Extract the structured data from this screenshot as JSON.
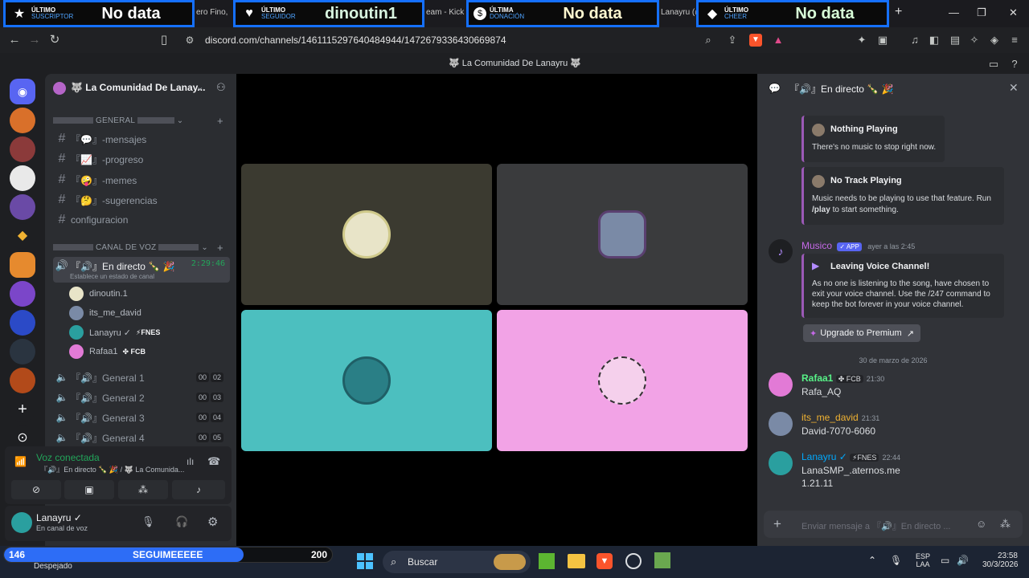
{
  "overlay": {
    "widgets": [
      {
        "small_top": "ÚLTIMO",
        "small_bottom": "SUSCRIPTOR",
        "value": "No data",
        "icon": "star-icon"
      },
      {
        "small_top": "ÚLTIMO",
        "small_bottom": "SEGUIDOR",
        "value": "dinoutin1",
        "icon": "heart-icon"
      },
      {
        "small_top": "ÚLTIMA",
        "small_bottom": "DONACIÓN",
        "value": "No data",
        "icon": "dollar-icon"
      },
      {
        "small_top": "ÚLTIMO",
        "small_bottom": "CHEER",
        "value": "No data",
        "icon": "diamond-icon"
      }
    ],
    "tab_fragments": [
      "ero Fino,",
      "eam - Kick",
      "Lanayru (@"
    ],
    "follow_bar": {
      "current": "146",
      "label": "SEGUIMEEEEE",
      "goal": "200",
      "progress": 0.73
    },
    "weather": "Despejado"
  },
  "browser": {
    "url": "discord.com/channels/1461115297640484944/1472679336430669874",
    "new_tab": "+",
    "window_controls": [
      "—",
      "❐",
      "✕"
    ]
  },
  "discord_title": "🐺 La Comunidad De Lanayru 🐺",
  "server": {
    "name": "🐺 La Comunidad De Lanay...",
    "categories": {
      "general": "GENERAL",
      "voice": "CANAL DE VOZ"
    },
    "text_channels": [
      {
        "label": "『💬』-mensajes"
      },
      {
        "label": "『📈』-progreso"
      },
      {
        "label": "『🤪』-memes"
      },
      {
        "label": "『🤔』-sugerencias"
      },
      {
        "label": "configuracion"
      }
    ],
    "active_voice": {
      "label": "『🔊』En directo 🍾 🎉",
      "timer": "2:29:46",
      "status": "Establece un estado de canal"
    },
    "voice_users": [
      {
        "name": "dinoutin.1",
        "tag": ""
      },
      {
        "name": "its_me_david",
        "tag": ""
      },
      {
        "name": "Lanayru ✓",
        "tag": "⚡FNES"
      },
      {
        "name": "Rafaa1",
        "tag": "✤ FCB"
      }
    ],
    "voice_channels": [
      {
        "label": "『🔊』General 1",
        "a": "00",
        "b": "02"
      },
      {
        "label": "『🔊』General 2",
        "a": "00",
        "b": "03"
      },
      {
        "label": "『🔊』General 3",
        "a": "00",
        "b": "04"
      },
      {
        "label": "『🔊』General 4",
        "a": "00",
        "b": "05"
      }
    ]
  },
  "voice_panel": {
    "status": "Voz conectada",
    "location": "『🔊』En directo 🍾 🎉 / 🐺 La Comunida..."
  },
  "user_panel": {
    "name": "Lanayru ✓",
    "status": "En canal de voz"
  },
  "stage": {
    "tiles": [
      {
        "bg": "#3b3a30",
        "avatar_bg": "#e8e4c8"
      },
      {
        "bg": "#3a3b3d",
        "avatar_bg": "#7a8aa6"
      },
      {
        "bg": "#4cbfbf",
        "avatar_bg": "#2a7f86"
      },
      {
        "bg": "#f2a3e6",
        "avatar_bg": "#b4568f"
      }
    ]
  },
  "chat": {
    "header": "『🔊』En directo 🍾 🎉",
    "embeds": [
      {
        "title": "Nothing Playing",
        "body": "There's no music to stop right now."
      },
      {
        "title": "No Track Playing",
        "body_a": "Music needs to be playing to use that feature. Run",
        "body_b": "/play",
        "body_c": " to start something."
      }
    ],
    "bot": {
      "name": "Musico",
      "badge": "✓ APP",
      "time": "ayer a las 2:45",
      "embed_title": "Leaving Voice Channel!",
      "embed_body": "As no one is listening to the song, have chosen to exit your voice channel. Use the /247 command to keep the bot forever in your voice channel.",
      "button": "Upgrade to Premium"
    },
    "date_divider": "30 de marzo de 2026",
    "messages": [
      {
        "name": "Rafaa1",
        "tag": "✤ FCB",
        "time": "21:30",
        "lines": [
          "Rafa_AQ"
        ],
        "color": "#57f287"
      },
      {
        "name": "its_me_david",
        "tag": "",
        "time": "21:31",
        "lines": [
          "David-7070-6060"
        ],
        "color": "#f0b232"
      },
      {
        "name": "Lanayru ✓",
        "tag": "⚡FNES",
        "time": "22:44",
        "lines": [
          "LanaSMP_.aternos.me",
          "1.21.11"
        ],
        "color": "#00a8fc"
      }
    ],
    "input_placeholder": "Enviar mensaje a 『🔊』En directo ..."
  },
  "taskbar": {
    "search": "Buscar",
    "lang_top": "ESP",
    "lang_bottom": "LAA",
    "time": "23:58",
    "date": "30/3/2026"
  }
}
